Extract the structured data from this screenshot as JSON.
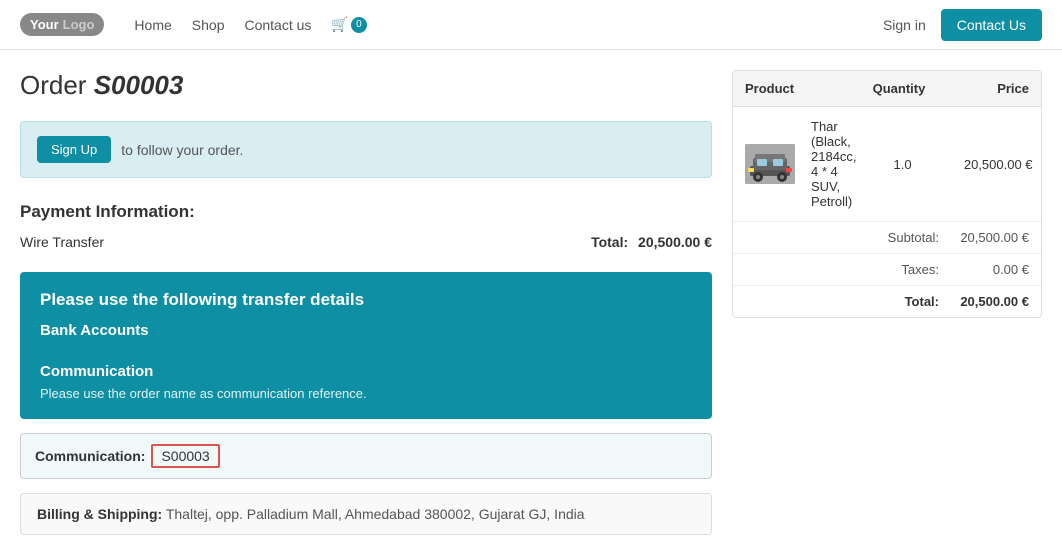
{
  "header": {
    "logo_your": "Your",
    "logo_logo": "Logo",
    "nav": [
      {
        "label": "Home",
        "href": "#"
      },
      {
        "label": "Shop",
        "href": "#"
      },
      {
        "label": "Contact us",
        "href": "#"
      }
    ],
    "cart_count": "0",
    "sign_in": "Sign in",
    "contact_btn": "Contact Us"
  },
  "order": {
    "title_prefix": "Order",
    "title_id": "S00003"
  },
  "signup_banner": {
    "btn_label": "Sign Up",
    "text": "to follow your order."
  },
  "payment": {
    "section_title": "Payment Information:",
    "method": "Wire Transfer",
    "total_label": "Total:",
    "total_value": "20,500.00 €"
  },
  "transfer": {
    "heading": "Please use the following transfer details",
    "bank_accounts_label": "Bank Accounts",
    "communication_heading": "Communication",
    "communication_note": "Please use the order name as communication reference."
  },
  "communication_field": {
    "label": "Communication:",
    "value": "S00003"
  },
  "billing": {
    "label": "Billing & Shipping:",
    "address": "Thaltej, opp. Palladium Mall, Ahmedabad 380002, Gujarat GJ, India"
  },
  "order_table": {
    "headers": {
      "product": "Product",
      "quantity": "Quantity",
      "price": "Price"
    },
    "items": [
      {
        "name": "Thar (Black, 2184cc, 4 * 4 SUV, Petroll)",
        "qty": "1.0",
        "price": "20,500.00 €"
      }
    ],
    "subtotal_label": "Subtotal:",
    "subtotal_value": "20,500.00 €",
    "taxes_label": "Taxes:",
    "taxes_value": "0.00 €",
    "total_label": "Total:",
    "total_value": "20,500.00 €"
  }
}
